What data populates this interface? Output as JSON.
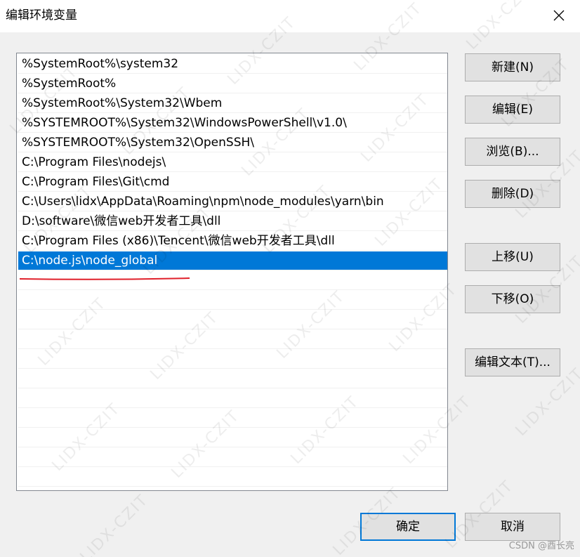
{
  "window": {
    "title": "编辑环境变量"
  },
  "path_list": {
    "items": [
      "%SystemRoot%\\system32",
      "%SystemRoot%",
      "%SystemRoot%\\System32\\Wbem",
      "%SYSTEMROOT%\\System32\\WindowsPowerShell\\v1.0\\",
      "%SYSTEMROOT%\\System32\\OpenSSH\\",
      "C:\\Program Files\\nodejs\\",
      "C:\\Program Files\\Git\\cmd",
      "C:\\Users\\lidx\\AppData\\Roaming\\npm\\node_modules\\yarn\\bin",
      "D:\\software\\微信web开发者工具\\dll",
      "C:\\Program Files (x86)\\Tencent\\微信web开发者工具\\dll",
      "C:\\node.js\\node_global"
    ],
    "selected_index": 10
  },
  "buttons": {
    "new": "新建(N)",
    "edit": "编辑(E)",
    "browse": "浏览(B)...",
    "delete": "删除(D)",
    "move_up": "上移(U)",
    "move_down": "下移(O)",
    "edit_text": "编辑文本(T)...",
    "ok": "确定",
    "cancel": "取消"
  },
  "watermark": {
    "text": "LIDX-CZIT",
    "credit": "CSDN @酉长亮"
  },
  "colors": {
    "selection": "#0078d7",
    "annotation_underline": "#e0202a"
  }
}
